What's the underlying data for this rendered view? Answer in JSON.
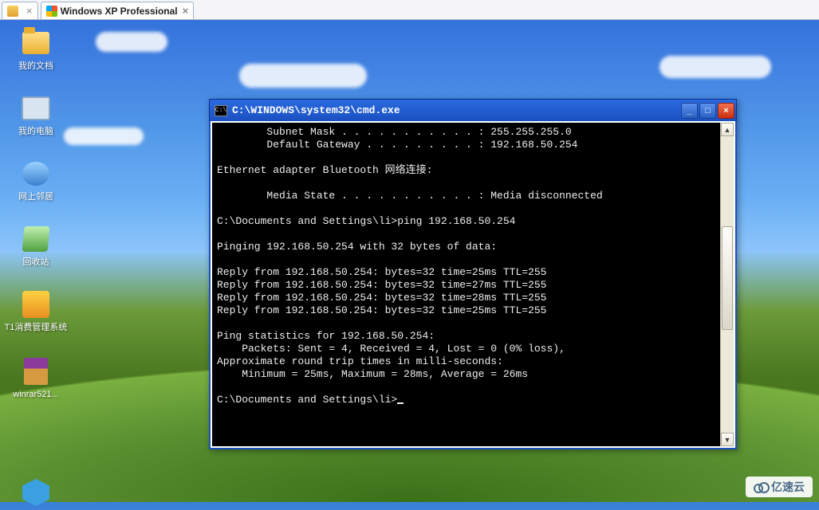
{
  "host_tabs": {
    "tab1_label": "",
    "tab2_label": "Windows XP Professional"
  },
  "desktop_icons": {
    "mydocs": "我的文档",
    "mycomputer": "我的电脑",
    "netplaces": "网上邻居",
    "recycle": "回收站",
    "t1app": "T1消费管理系统",
    "winrar": "winrar521...",
    "cube": ""
  },
  "cmd_window": {
    "title": "C:\\WINDOWS\\system32\\cmd.exe",
    "app_icon_text": "C:\\",
    "lines": [
      "        Subnet Mask . . . . . . . . . . . : 255.255.255.0",
      "        Default Gateway . . . . . . . . . : 192.168.50.254",
      "",
      "Ethernet adapter Bluetooth 网络连接:",
      "",
      "        Media State . . . . . . . . . . . : Media disconnected",
      "",
      "C:\\Documents and Settings\\li>ping 192.168.50.254",
      "",
      "Pinging 192.168.50.254 with 32 bytes of data:",
      "",
      "Reply from 192.168.50.254: bytes=32 time=25ms TTL=255",
      "Reply from 192.168.50.254: bytes=32 time=27ms TTL=255",
      "Reply from 192.168.50.254: bytes=32 time=28ms TTL=255",
      "Reply from 192.168.50.254: bytes=32 time=25ms TTL=255",
      "",
      "Ping statistics for 192.168.50.254:",
      "    Packets: Sent = 4, Received = 4, Lost = 0 (0% loss),",
      "Approximate round trip times in milli-seconds:",
      "    Minimum = 25ms, Maximum = 28ms, Average = 26ms",
      "",
      "C:\\Documents and Settings\\li>"
    ]
  },
  "watermark": "亿速云"
}
